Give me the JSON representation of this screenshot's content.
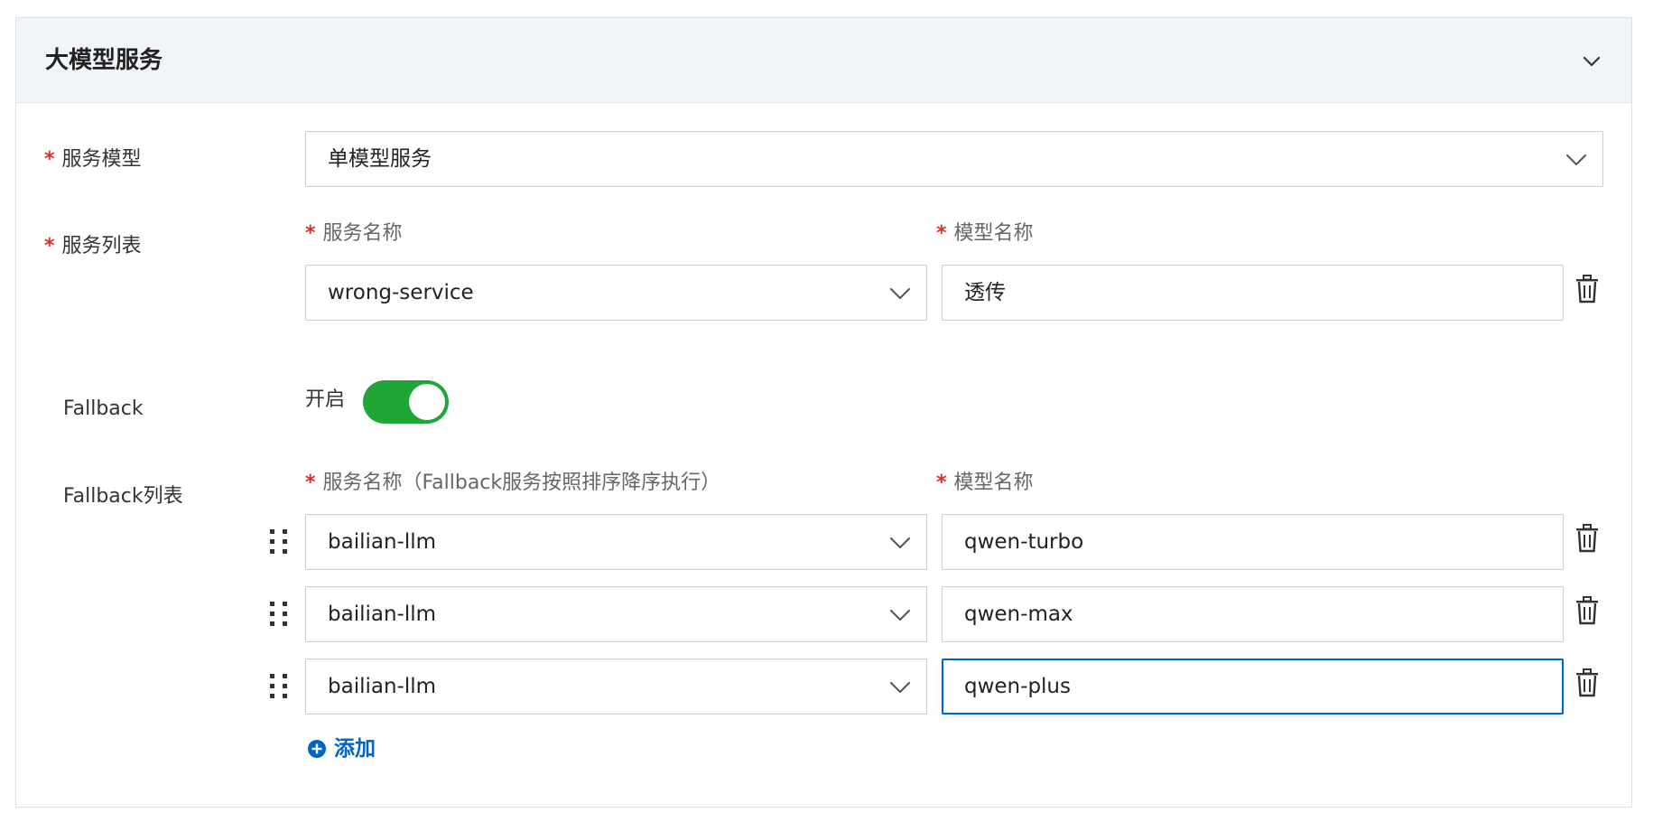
{
  "panel": {
    "title": "大模型服务"
  },
  "service_model": {
    "label": "服务模型",
    "required": "*",
    "value": "单模型服务"
  },
  "service_list": {
    "label": "服务列表",
    "required": "*",
    "col_service": "服务名称",
    "col_model": "模型名称",
    "row": {
      "service": "wrong-service",
      "model": "透传"
    }
  },
  "fallback": {
    "label": "Fallback",
    "toggle_label": "开启",
    "enabled": true
  },
  "fallback_list": {
    "label": "Fallback列表",
    "required": "*",
    "col_service": "服务名称（Fallback服务按照排序降序执行）",
    "col_model": "模型名称",
    "rows": [
      {
        "service": "bailian-llm",
        "model": "qwen-turbo"
      },
      {
        "service": "bailian-llm",
        "model": "qwen-max"
      },
      {
        "service": "bailian-llm",
        "model": "qwen-plus"
      }
    ],
    "add_label": "添加"
  },
  "colors": {
    "accent": "#0064c8",
    "toggle_on": "#1fa637",
    "required": "#d93026"
  },
  "icons": [
    "chevron-down-icon",
    "trash-icon",
    "drag-handle-icon",
    "plus-circle-icon"
  ]
}
